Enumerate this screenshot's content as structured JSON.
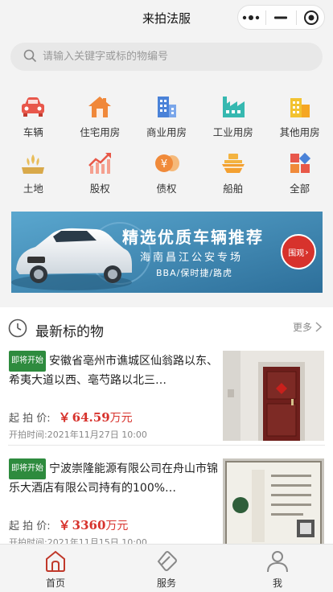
{
  "header": {
    "title": "来拍法服"
  },
  "capsule": {
    "more_icon": "more-dots-icon",
    "minimize_icon": "minimize-icon",
    "close_icon": "target-close-icon"
  },
  "search": {
    "placeholder": "请输入关键字或标的物编号",
    "icon": "search-icon"
  },
  "categories": [
    {
      "label": "车辆",
      "icon": "car-icon",
      "color": "#e8574b"
    },
    {
      "label": "住宅用房",
      "icon": "house-icon",
      "color": "#f0883a"
    },
    {
      "label": "商业用房",
      "icon": "office-building-icon",
      "color": "#4a82d8"
    },
    {
      "label": "工业用房",
      "icon": "factory-icon",
      "color": "#36b8b0"
    },
    {
      "label": "其他用房",
      "icon": "buildings-icon",
      "color": "#f2c230"
    },
    {
      "label": "土地",
      "icon": "land-icon",
      "color": "#e8bd5a"
    },
    {
      "label": "股权",
      "icon": "stock-chart-icon",
      "color": "#e85848"
    },
    {
      "label": "债权",
      "icon": "yen-coin-icon",
      "color": "#f08a3a"
    },
    {
      "label": "船舶",
      "icon": "ship-icon",
      "color": "#f3b340"
    },
    {
      "label": "全部",
      "icon": "grid-all-icon",
      "color": "#e8574b"
    }
  ],
  "banner": {
    "headline": "精选优质车辆推荐",
    "subline": "海南昌江公安专场",
    "brands": "BBA/保时捷/路虎",
    "cta": "围观"
  },
  "latest": {
    "title": "最新标的物",
    "more": "更多",
    "items": [
      {
        "badge": "即将开始",
        "name": "安徽省亳州市谯城区仙翁路以东、希夷大道以西、亳芍路以北三…",
        "price_label": "起 拍 价:",
        "currency": "￥",
        "price": "64.59",
        "unit": "万元",
        "time_label": "开拍时间:",
        "time": "2021年11月27日 10:00"
      },
      {
        "badge": "即将开始",
        "name": "宁波崇隆能源有限公司在舟山市锦乐大酒店有限公司持有的100%…",
        "price_label": "起 拍 价:",
        "currency": "￥",
        "price": "3360",
        "unit": "万元",
        "time_label": "开拍时间:",
        "time": "2021年11月15日 10:00"
      }
    ]
  },
  "tabbar": [
    {
      "label": "首页",
      "icon": "home-icon",
      "active": true
    },
    {
      "label": "服务",
      "icon": "service-icon",
      "active": false
    },
    {
      "label": "我",
      "icon": "user-icon",
      "active": false
    }
  ],
  "colors": {
    "accent_red": "#d7322c",
    "badge_green": "#2e8b3e",
    "banner_blue": "#2d6f9a"
  }
}
